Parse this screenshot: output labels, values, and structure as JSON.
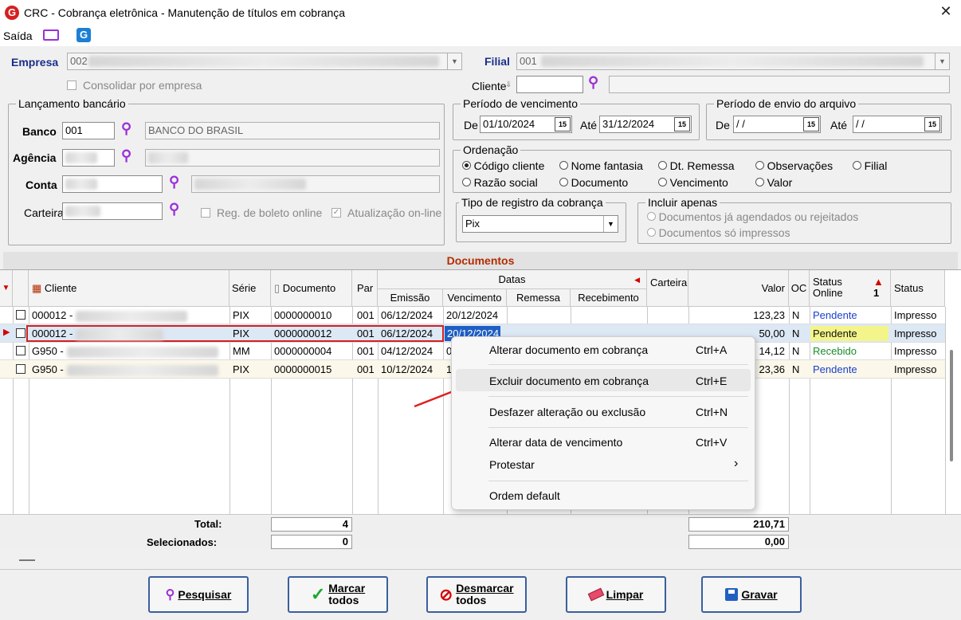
{
  "window": {
    "title": "CRC - Cobrança eletrônica - Manutenção de títulos em cobrança",
    "close": "✕",
    "logo": "G"
  },
  "menu": {
    "saida": "Saída"
  },
  "empresa": {
    "label": "Empresa",
    "value": "002",
    "consolidar": "Consolidar por empresa"
  },
  "filial": {
    "label": "Filial",
    "value": "001"
  },
  "cliente": {
    "label": "Cliente"
  },
  "lancamento": {
    "title": "Lançamento bancário",
    "banco_label": "Banco",
    "banco_value": "001",
    "banco_name": "BANCO DO BRASIL",
    "agencia_label": "Agência",
    "conta_label": "Conta",
    "carteira_label": "Carteira",
    "reg_boleto": "Reg. de boleto online",
    "atualizacao": "Atualização on-line"
  },
  "vencimento": {
    "title": "Período de vencimento",
    "de_label": "De",
    "de_value": "01/10/2024",
    "ate_label": "Até",
    "ate_value": "31/12/2024"
  },
  "envio": {
    "title": "Período de envio do arquivo",
    "de_label": "De",
    "de_value": " / /",
    "ate_label": "Até",
    "ate_value": " / /"
  },
  "ordenacao": {
    "title": "Ordenação",
    "options": [
      "Código cliente",
      "Nome fantasia",
      "Dt. Remessa",
      "Observações",
      "Filial",
      "Razão social",
      "Documento",
      "Vencimento",
      "Valor"
    ]
  },
  "tipo_registro": {
    "title": "Tipo de registro da cobrança",
    "value": "Pix"
  },
  "incluir": {
    "title": "Incluir apenas",
    "opt1": "Documentos já agendados ou rejeitados",
    "opt2": "Documentos só impressos"
  },
  "documentos": {
    "title": "Documentos"
  },
  "grid": {
    "headers": {
      "cliente": "Cliente",
      "serie": "Série",
      "documento": "Documento",
      "par": "Par",
      "datas": "Datas",
      "emissao": "Emissão",
      "vencimento": "Vencimento",
      "remessa": "Remessa",
      "recebimento": "Recebimento",
      "carteira": "Carteira",
      "valor": "Valor",
      "oc": "OC",
      "status_online": "Status Online",
      "status": "Status",
      "sort_marker": "1"
    },
    "rows": [
      {
        "cliente": "000012 -",
        "serie": "PIX",
        "documento": "0000000010",
        "par": "001",
        "emissao": "06/12/2024",
        "vencimento": "20/12/2024",
        "valor": "123,23",
        "oc": "N",
        "status_online": "Pendente",
        "status": "Impresso"
      },
      {
        "cliente": "000012 -",
        "serie": "PIX",
        "documento": "0000000012",
        "par": "001",
        "emissao": "06/12/2024",
        "vencimento": "20/12/2024",
        "valor": "50,00",
        "oc": "N",
        "status_online": "Pendente",
        "status": "Impresso"
      },
      {
        "cliente": "G950 -",
        "serie": "MM",
        "documento": "0000000004",
        "par": "001",
        "emissao": "04/12/2024",
        "vencimento": "0",
        "valor": "14,12",
        "oc": "N",
        "status_online": "Recebido",
        "status": "Impresso"
      },
      {
        "cliente": "G950 -",
        "serie": "PIX",
        "documento": "0000000015",
        "par": "001",
        "emissao": "10/12/2024",
        "vencimento": "1",
        "valor": "23,36",
        "oc": "N",
        "status_online": "Pendente",
        "status": "Impresso"
      }
    ],
    "totals": {
      "total_label": "Total:",
      "total_count": "4",
      "total_valor": "210,71",
      "sel_label": "Selecionados:",
      "sel_count": "0",
      "sel_valor": "0,00"
    }
  },
  "context_menu": {
    "items": [
      {
        "label": "Alterar documento em cobrança",
        "key": "Ctrl+A"
      },
      {
        "label": "Excluir documento em cobrança",
        "key": "Ctrl+E"
      },
      {
        "label": "Desfazer alteração ou exclusão",
        "key": "Ctrl+N"
      },
      {
        "label": "Alterar data de vencimento",
        "key": "Ctrl+V"
      },
      {
        "label": "Protestar",
        "key": "›"
      },
      {
        "label": "Ordem default",
        "key": ""
      }
    ]
  },
  "buttons": {
    "pesquisar": "Pesquisar",
    "marcar_1": "Marcar",
    "marcar_2": "todos",
    "desmarcar_1": "Desmarcar",
    "desmarcar_2": "todos",
    "limpar": "Limpar",
    "gravar": "Gravar"
  },
  "colors": {
    "accent": "#9b30d9",
    "status_pendente": "#1a3fcc",
    "status_recebido": "#1a8a2a",
    "doc_title": "#b32c00"
  }
}
